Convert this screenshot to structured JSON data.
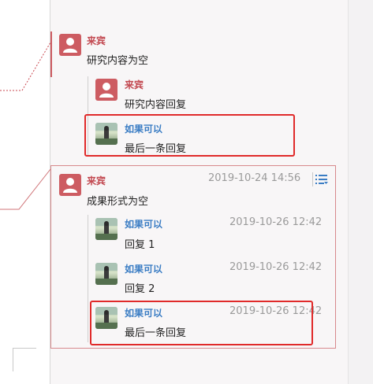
{
  "threads": [
    {
      "author": "来宾",
      "text": "研究内容为空",
      "replies": [
        {
          "author": "来宾",
          "text": "研究内容回复",
          "time": ""
        },
        {
          "author": "如果可以",
          "text": "最后一条回复",
          "time": ""
        }
      ]
    },
    {
      "author": "来宾",
      "text": "成果形式为空",
      "time": "2019-10-24 14:56",
      "replies": [
        {
          "author": "如果可以",
          "text": "回复 1",
          "time": "2019-10-26 12:42"
        },
        {
          "author": "如果可以",
          "text": "回复 2",
          "time": "2019-10-26 12:42"
        },
        {
          "author": "如果可以",
          "text": "最后一条回复",
          "time": "2019-10-26 12:42"
        }
      ]
    }
  ],
  "icons": {
    "guest_avatar": "person-icon",
    "user_avatar": "photo-avatar",
    "thread_menu": "list-menu-icon"
  },
  "colors": {
    "guest": "#c2474f",
    "user": "#3b7dc4",
    "highlight": "#e02a2a",
    "menu": "#3b7dc4"
  }
}
